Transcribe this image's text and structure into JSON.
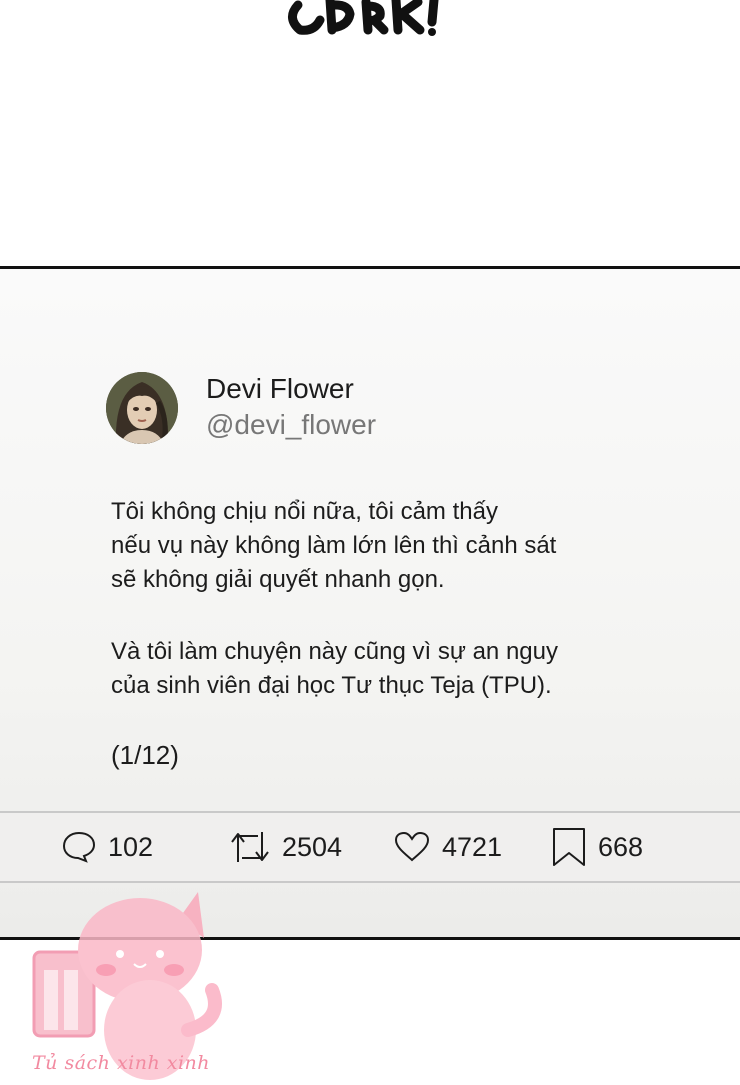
{
  "post": {
    "author_name": "Devi Flower",
    "handle": "@devi_flower",
    "lines": [
      "Tôi không chịu nổi nữa, tôi cảm thấy",
      "nếu vụ này không làm lớn lên thì cảnh sát",
      "sẽ không giải quyết nhanh gọn.",
      "Và tôi làm chuyện này cũng vì sự an nguy",
      "của sinh viên đại học Tư thục Teja (TPU).",
      "(1/12)"
    ]
  },
  "actions": {
    "replies": "102",
    "retweets": "2504",
    "likes": "4721",
    "bookmarks": "668"
  },
  "watermark": {
    "text": "Tủ sách xinh xinh"
  },
  "icons": {
    "reply": "speech-bubble-icon",
    "retweet": "retweet-icon",
    "like": "heart-icon",
    "bookmark": "bookmark-icon"
  }
}
